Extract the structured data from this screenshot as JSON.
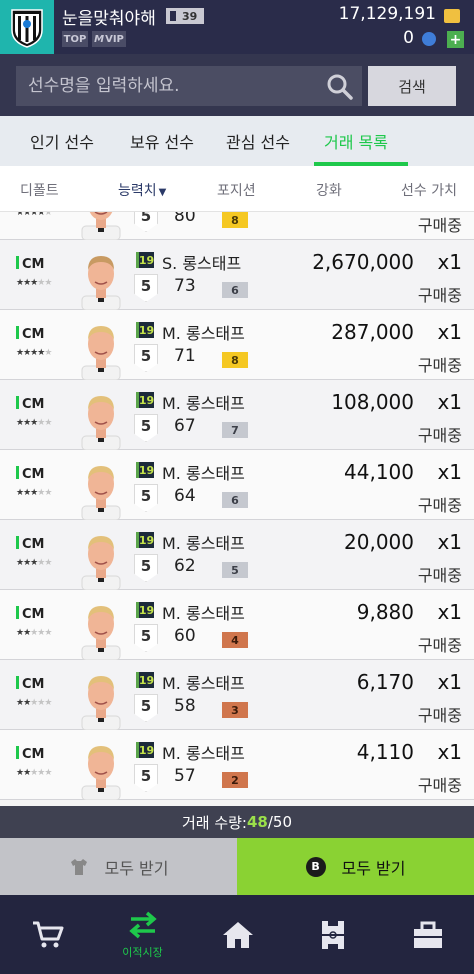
{
  "header": {
    "nickname": "눈을맞춰야해",
    "level": "39",
    "tags": [
      "TOP",
      "VIP"
    ],
    "coins": "17,129,191",
    "cash": "0"
  },
  "search": {
    "placeholder": "선수명을 입력하세요.",
    "button_label": "검색"
  },
  "tabs": [
    {
      "label": "인기 선수",
      "active": false
    },
    {
      "label": "보유 선수",
      "active": false
    },
    {
      "label": "관심 선수",
      "active": false
    },
    {
      "label": "거래 목록",
      "active": true
    }
  ],
  "sort": [
    "디폴트",
    "능력치",
    "포지션",
    "강화",
    "선수 가치"
  ],
  "list": {
    "partial_row": {
      "stars": 4,
      "grade": "5",
      "ovr": "80",
      "upgrade": "8",
      "upgrade_tier": "gold",
      "status": "구매중"
    },
    "rows": [
      {
        "pos": "CM",
        "stars": 3,
        "season": "19",
        "name": "S. 롱스태프",
        "grade": "5",
        "ovr": "73",
        "upgrade": "6",
        "upgrade_tier": "silver",
        "price": "2,670,000",
        "qty": "x1",
        "status": "구매중"
      },
      {
        "pos": "CM",
        "stars": 4,
        "season": "19",
        "name": "M. 롱스태프",
        "grade": "5",
        "ovr": "71",
        "upgrade": "8",
        "upgrade_tier": "gold",
        "price": "287,000",
        "qty": "x1",
        "status": "구매중"
      },
      {
        "pos": "CM",
        "stars": 3,
        "season": "19",
        "name": "M. 롱스태프",
        "grade": "5",
        "ovr": "67",
        "upgrade": "7",
        "upgrade_tier": "silver",
        "price": "108,000",
        "qty": "x1",
        "status": "구매중"
      },
      {
        "pos": "CM",
        "stars": 3,
        "season": "19",
        "name": "M. 롱스태프",
        "grade": "5",
        "ovr": "64",
        "upgrade": "6",
        "upgrade_tier": "silver",
        "price": "44,100",
        "qty": "x1",
        "status": "구매중"
      },
      {
        "pos": "CM",
        "stars": 3,
        "season": "19",
        "name": "M. 롱스태프",
        "grade": "5",
        "ovr": "62",
        "upgrade": "5",
        "upgrade_tier": "silver",
        "price": "20,000",
        "qty": "x1",
        "status": "구매중"
      },
      {
        "pos": "CM",
        "stars": 2,
        "season": "19",
        "name": "M. 롱스태프",
        "grade": "5",
        "ovr": "60",
        "upgrade": "4",
        "upgrade_tier": "bronze",
        "price": "9,880",
        "qty": "x1",
        "status": "구매중"
      },
      {
        "pos": "CM",
        "stars": 2,
        "season": "19",
        "name": "M. 롱스태프",
        "grade": "5",
        "ovr": "58",
        "upgrade": "3",
        "upgrade_tier": "bronze",
        "price": "6,170",
        "qty": "x1",
        "status": "구매중"
      },
      {
        "pos": "CM",
        "stars": 2,
        "season": "19",
        "name": "M. 롱스태프",
        "grade": "5",
        "ovr": "57",
        "upgrade": "2",
        "upgrade_tier": "bronze",
        "price": "4,110",
        "qty": "x1",
        "status": "구매중"
      }
    ]
  },
  "trade_count": {
    "label": "거래 수량: ",
    "current": "48",
    "total": "/50"
  },
  "buttons": {
    "receive_all_left": "모두 받기",
    "receive_all_right": "모두 받기",
    "b_icon": "B"
  },
  "nav": {
    "items": [
      "cart-icon",
      "transfer-icon",
      "home-icon",
      "field-icon",
      "briefcase-icon"
    ],
    "active_label": "이적시장"
  },
  "colors": {
    "accent_green": "#1ec84b",
    "header_bg": "#2a2c4a",
    "receive_button": "#8ad233"
  }
}
